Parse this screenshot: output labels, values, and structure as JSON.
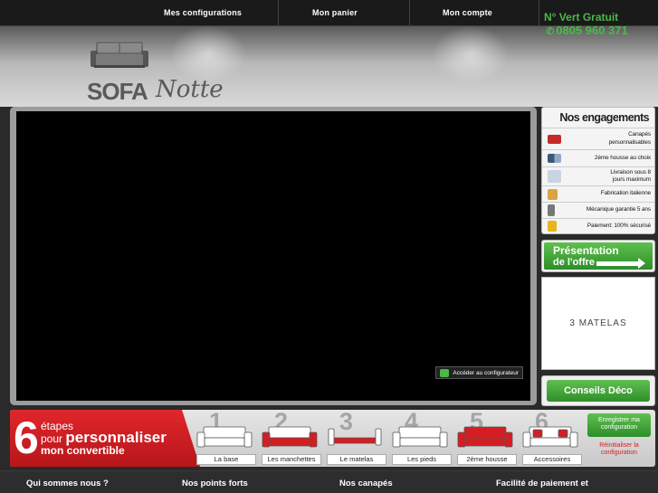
{
  "nav": {
    "items": [
      {
        "label": "Mes configurations"
      },
      {
        "label": "Mon panier"
      },
      {
        "label": "Mon compte"
      }
    ]
  },
  "phone": {
    "label": "N° Vert Gratuit",
    "number": "0805 960 371"
  },
  "logo": {
    "part1": "SOFA",
    "part2": "Notte"
  },
  "video": {
    "configurator_button": "Accéder au configurateur"
  },
  "engagements": {
    "title": "Nos engagements",
    "items": [
      {
        "label": "Canapés personnalisables",
        "icon": "red-sofa-icon"
      },
      {
        "label": "2ème housse au choix",
        "icon": "fabric-swatch-icon"
      },
      {
        "label": "Livraison sous 8 jours maximum",
        "icon": "calendar-icon"
      },
      {
        "label": "Fabrication italienne",
        "icon": "hand-icon"
      },
      {
        "label": "Mécanique garantie 5 ans",
        "icon": "mechanism-icon"
      },
      {
        "label": "Paiement: 100% sécurisé",
        "icon": "lock-icon"
      }
    ]
  },
  "presentation": {
    "line1": "Présentation",
    "line2": "de l'offre"
  },
  "matelas_banner": "3 MATELAS",
  "conseils": "Conseils Déco",
  "steps": {
    "big_number": "6",
    "line1": "étapes",
    "line2_prefix": "pour",
    "line2_bold": "personnaliser",
    "line3": "mon convertible",
    "items": [
      {
        "num": "1",
        "label": "La base"
      },
      {
        "num": "2",
        "label": "Les manchettes"
      },
      {
        "num": "3",
        "label": "Le matelas"
      },
      {
        "num": "4",
        "label": "Les pieds"
      },
      {
        "num": "5",
        "label": "2ème housse"
      },
      {
        "num": "6",
        "label": "Accessoires"
      }
    ],
    "save": "Enregistrer ma configuration",
    "reset": "Réinitialiser la configuration"
  },
  "footer": {
    "items": [
      {
        "label": "Qui sommes nous ?"
      },
      {
        "label": "Nos points forts"
      },
      {
        "label": "Nos canapés"
      },
      {
        "label": "Facilité de paiement et"
      }
    ]
  },
  "colors": {
    "brand_green": "#4db848",
    "brand_red": "#d41e24"
  }
}
